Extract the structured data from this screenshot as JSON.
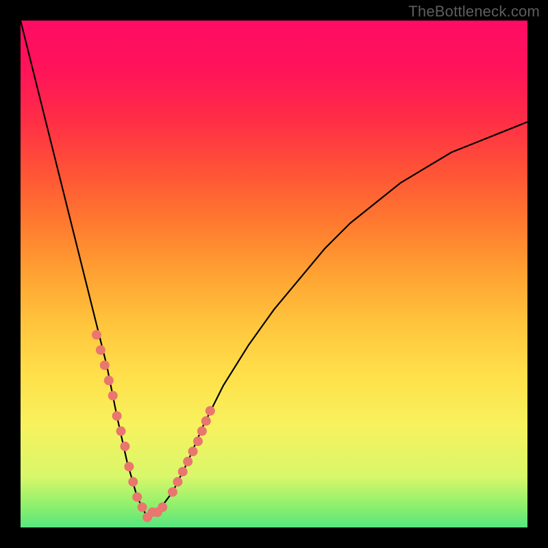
{
  "watermark": "TheBottleneck.com",
  "chart_data": {
    "type": "line",
    "title": "",
    "xlabel": "",
    "ylabel": "",
    "xlim": [
      0,
      100
    ],
    "ylim": [
      0,
      100
    ],
    "note": "V-shaped bottleneck curve on a red→green gradient background. Minimum at x≈25. Values are percent of vertical span (0 = bottom/green, 100 = top/red), estimated visually.",
    "series": [
      {
        "name": "bottleneck-curve",
        "x": [
          0,
          2,
          5,
          8,
          11,
          14,
          17,
          19,
          21,
          23,
          25,
          27,
          30,
          33,
          36,
          40,
          45,
          50,
          55,
          60,
          65,
          70,
          75,
          80,
          85,
          90,
          95,
          100
        ],
        "values": [
          100,
          92,
          80,
          68,
          56,
          44,
          32,
          22,
          13,
          6,
          2,
          3,
          7,
          13,
          20,
          28,
          36,
          43,
          49,
          55,
          60,
          64,
          68,
          71,
          74,
          76,
          78,
          80
        ]
      }
    ],
    "highlight_points": {
      "note": "Salmon dots clustered along the curve near the trough, both branches.",
      "color": "#e9766f",
      "x": [
        15.0,
        15.8,
        16.6,
        17.4,
        18.2,
        19.0,
        19.8,
        20.6,
        21.4,
        22.2,
        23.0,
        24.0,
        25.0,
        26.0,
        27.0,
        28.0,
        30.0,
        31.0,
        32.0,
        33.0,
        34.0,
        35.0,
        35.8,
        36.6,
        37.4
      ],
      "values": [
        38,
        35,
        32,
        29,
        26,
        22,
        19,
        16,
        12,
        9,
        6,
        4,
        2,
        3,
        3,
        4,
        7,
        9,
        11,
        13,
        15,
        17,
        19,
        21,
        23
      ]
    }
  }
}
